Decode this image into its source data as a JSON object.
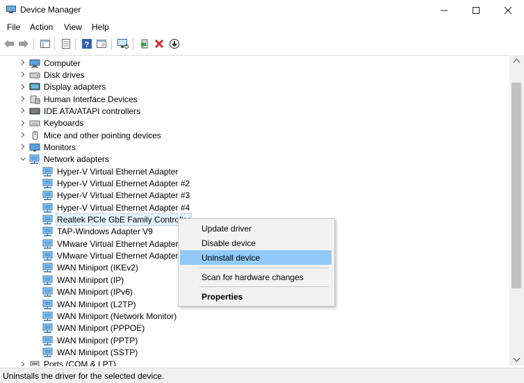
{
  "window": {
    "title": "Device Manager",
    "minimize": "—",
    "maximize": "☐",
    "close": "✕"
  },
  "menu": [
    "File",
    "Action",
    "View",
    "Help"
  ],
  "toolbar": [
    "back-icon",
    "forward-icon",
    "view-icon",
    "properties-icon",
    "help-icon",
    "details-icon",
    "scan-icon",
    "add-driver-icon",
    "uninstall-icon",
    "update-icon"
  ],
  "tree": {
    "categories": [
      {
        "label": "Computer",
        "icon": "computer-icon"
      },
      {
        "label": "Disk drives",
        "icon": "disk-icon"
      },
      {
        "label": "Display adapters",
        "icon": "display-icon"
      },
      {
        "label": "Human Interface Devices",
        "icon": "hid-icon"
      },
      {
        "label": "IDE ATA/ATAPI controllers",
        "icon": "ide-icon"
      },
      {
        "label": "Keyboards",
        "icon": "keyboard-icon"
      },
      {
        "label": "Mice and other pointing devices",
        "icon": "mouse-icon"
      },
      {
        "label": "Monitors",
        "icon": "monitor-icon"
      }
    ],
    "network": {
      "label": "Network adapters",
      "children": [
        "Hyper-V Virtual Ethernet Adapter",
        "Hyper-V Virtual Ethernet Adapter #2",
        "Hyper-V Virtual Ethernet Adapter #3",
        "Hyper-V Virtual Ethernet Adapter #4",
        "Realtek PCIe GbE Family Controller",
        "TAP-Windows Adapter V9",
        "VMware Virtual Ethernet Adapter fo",
        "VMware Virtual Ethernet Adapter fo",
        "WAN Miniport (IKEv2)",
        "WAN Miniport (IP)",
        "WAN Miniport (IPv6)",
        "WAN Miniport (L2TP)",
        "WAN Miniport (Network Monitor)",
        "WAN Miniport (PPPOE)",
        "WAN Miniport (PPTP)",
        "WAN Miniport (SSTP)"
      ]
    },
    "after": "Ports (COM & LPT)"
  },
  "context_menu": {
    "update": "Update driver",
    "disable": "Disable device",
    "uninstall": "Uninstall device",
    "scan": "Scan for hardware changes",
    "properties": "Properties"
  },
  "status": "Uninstalls the driver for the selected device.",
  "colors": {
    "highlight": "#91c9f7",
    "menu_bg": "#f2f2f2",
    "uninstall_red": "#d32626"
  }
}
